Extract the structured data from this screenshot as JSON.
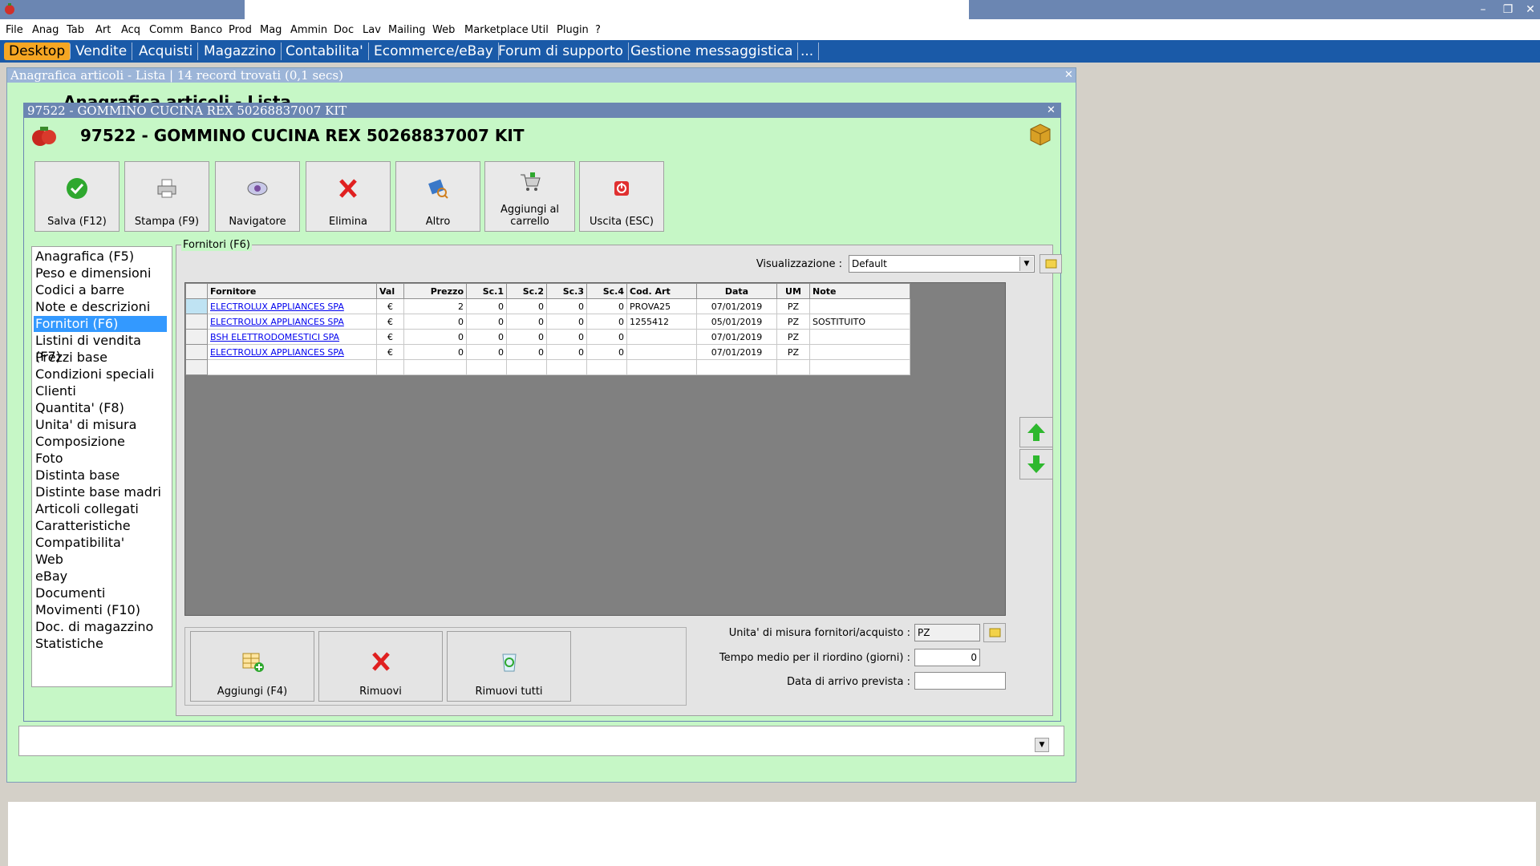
{
  "menu": [
    "File",
    "Anag",
    "Tab",
    "Art",
    "Acq",
    "Comm",
    "Banco",
    "Prod",
    "Mag",
    "Ammin",
    "Doc",
    "Lav",
    "Mailing",
    "Web",
    "Marketplace",
    "Util",
    "Plugin",
    "?"
  ],
  "tabs": [
    "Desktop",
    "Vendite",
    "Acquisti",
    "Magazzino",
    "Contabilita'",
    "Ecommerce/eBay",
    "Forum di supporto",
    "Gestione messaggistica",
    "..."
  ],
  "bg_window": {
    "title": "Anagrafica articoli  - Lista | 14 record trovati (0,1 secs)",
    "heading": "Anagrafica articoli - Lista"
  },
  "dialog": {
    "title": "97522 - GOMMINO CUCINA REX 50268837007 KIT",
    "heading": "97522 - GOMMINO CUCINA REX 50268837007 KIT",
    "toolbar": {
      "save": "Salva (F12)",
      "print": "Stampa (F9)",
      "navigator": "Navigatore",
      "delete": "Elimina",
      "other": "Altro",
      "add_cart_1": "Aggiungi al",
      "add_cart_2": "carrello",
      "exit": "Uscita (ESC)"
    },
    "nav": [
      "Anagrafica (F5)",
      "Peso e dimensioni",
      "Codici a barre",
      "Note e descrizioni",
      "Fornitori (F6)",
      "Listini di vendita (F7)",
      "Prezzi base",
      "Condizioni speciali",
      "Clienti",
      "Quantita' (F8)",
      "Unita' di misura",
      "Composizione",
      "Foto",
      "Distinta base",
      "Distinte base madri",
      "Articoli collegati",
      "Caratteristiche",
      "Compatibilita'",
      "Web",
      "eBay",
      "Documenti",
      "Movimenti (F10)",
      "Doc. di magazzino",
      "Statistiche"
    ],
    "nav_selected": 4,
    "group_label": "Fornitori (F6)",
    "view_label": "Visualizzazione :",
    "view_value": "Default",
    "grid": {
      "headers": [
        "Fornitore",
        "Val",
        "Prezzo",
        "Sc.1",
        "Sc.2",
        "Sc.3",
        "Sc.4",
        "Cod. Art",
        "Data",
        "UM",
        "Note"
      ],
      "rows": [
        [
          "ELECTROLUX APPLIANCES SPA",
          "€",
          "2",
          "0",
          "0",
          "0",
          "0",
          "PROVA25",
          "07/01/2019",
          "PZ",
          ""
        ],
        [
          "ELECTROLUX APPLIANCES SPA",
          "€",
          "0",
          "0",
          "0",
          "0",
          "0",
          "1255412",
          "05/01/2019",
          "PZ",
          "SOSTITUITO"
        ],
        [
          "BSH ELETTRODOMESTICI SPA",
          "€",
          "0",
          "0",
          "0",
          "0",
          "0",
          "",
          "07/01/2019",
          "PZ",
          ""
        ],
        [
          "ELECTROLUX APPLIANCES SPA",
          "€",
          "0",
          "0",
          "0",
          "0",
          "0",
          "",
          "07/01/2019",
          "PZ",
          ""
        ]
      ]
    },
    "bottom": {
      "add": "Aggiungi (F4)",
      "remove": "Rimuovi",
      "remove_all": "Rimuovi tutti"
    },
    "fields": {
      "um_label": "Unita' di misura fornitori/acquisto :",
      "um_value": "PZ",
      "lead_label": "Tempo medio per il riordino (giorni) :",
      "lead_value": "0",
      "arrival_label": "Data di arrivo prevista :",
      "arrival_value": ""
    }
  }
}
